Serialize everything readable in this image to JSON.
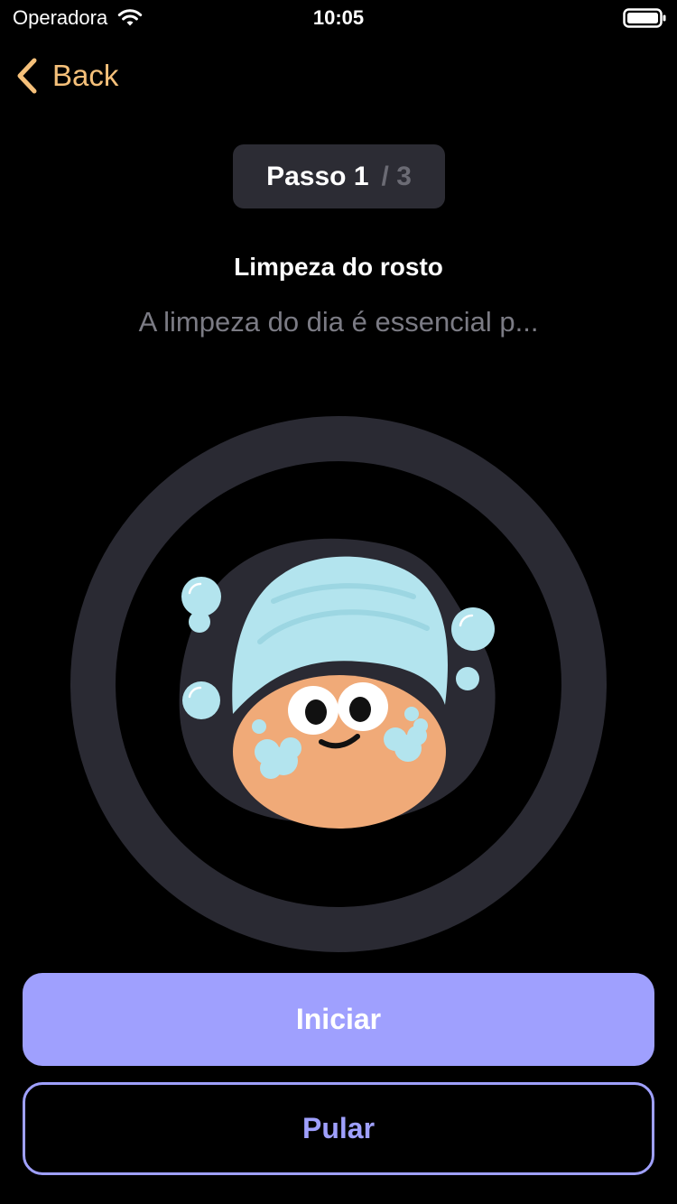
{
  "status_bar": {
    "carrier": "Operadora",
    "time": "10:05",
    "wifi_icon": "wifi-icon",
    "battery_icon": "battery-icon"
  },
  "nav": {
    "back_label": "Back",
    "back_icon": "chevron-left-icon"
  },
  "step": {
    "current": "Passo 1",
    "total": "/ 3"
  },
  "content": {
    "title": "Limpeza do rosto",
    "description": "A limpeza do dia é essencial p..."
  },
  "illustration": {
    "icon": "face-wash-towel-illustration"
  },
  "buttons": {
    "start_label": "Iniciar",
    "skip_label": "Pular"
  },
  "colors": {
    "background": "#000000",
    "accent": "#9fa0fe",
    "back_text": "#f5c07a",
    "pill_background": "#2c2c34",
    "ring": "#2a2a33",
    "towel": "#b3e4ee",
    "face": "#f0aa78"
  }
}
